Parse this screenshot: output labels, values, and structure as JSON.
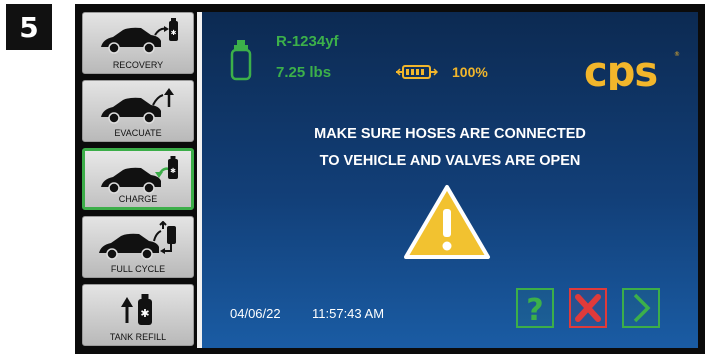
{
  "step_number": "5",
  "sidebar": {
    "items": [
      {
        "label": "RECOVERY",
        "icon": "car-recovery-icon",
        "active": false
      },
      {
        "label": "EVACUATE",
        "icon": "car-evacuate-icon",
        "active": false
      },
      {
        "label": "CHARGE",
        "icon": "car-charge-icon",
        "active": true
      },
      {
        "label": "FULL CYCLE",
        "icon": "car-full-cycle-icon",
        "active": false
      },
      {
        "label": "TANK REFILL",
        "icon": "tank-refill-icon",
        "active": false
      }
    ]
  },
  "status": {
    "refrigerant": "R-1234yf",
    "weight": "7.25 lbs",
    "battery_percent": "100%"
  },
  "brand": {
    "logo_text": "CPS"
  },
  "message": {
    "line1": "MAKE SURE HOSES ARE CONNECTED",
    "line2": "TO VEHICLE AND VALVES ARE OPEN"
  },
  "footer": {
    "date": "04/06/22",
    "time": "11:57:43 AM"
  },
  "controls": {
    "help_icon": "question-icon",
    "cancel_icon": "x-icon",
    "next_icon": "chevron-right-icon"
  },
  "colors": {
    "accent_green": "#3cb04a",
    "warning_yellow": "#f2b62b",
    "cancel_red": "#e03a3a",
    "screen_blue": "#123f78"
  }
}
